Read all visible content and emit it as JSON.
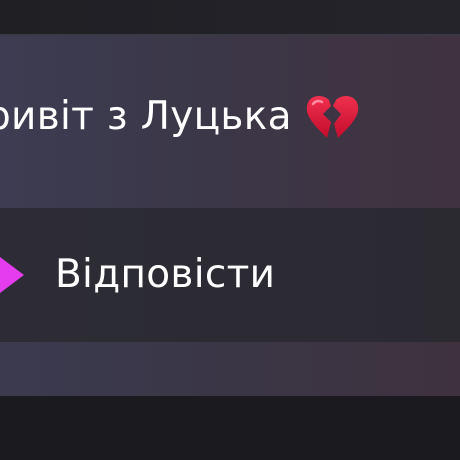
{
  "message": {
    "text": "ривіт з Луцька",
    "emoji_icon": "broken-heart-icon",
    "emoji_color": "#e0143c"
  },
  "reply_action": {
    "label": "Відповісти",
    "icon": "reply-arrow-icon",
    "icon_color": "#e53cf0"
  },
  "colors": {
    "background": "#1a1a1e",
    "message_card": "#3c3a4e",
    "reply_row": "#2c2b34",
    "text": "#ffffff"
  }
}
